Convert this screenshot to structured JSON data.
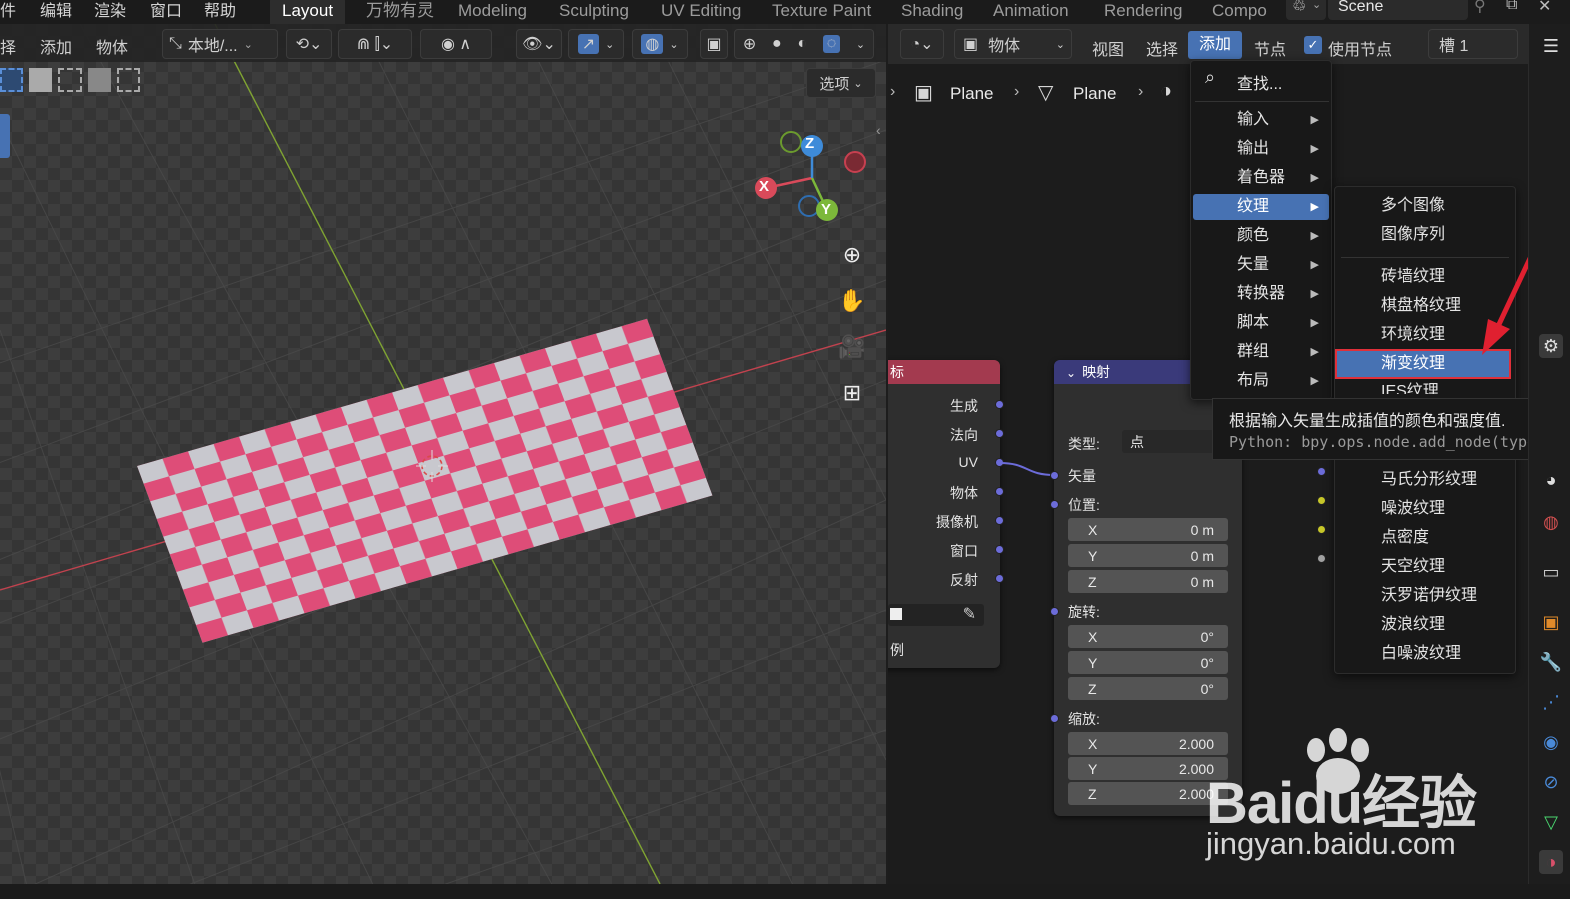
{
  "topbar": {
    "menus": [
      "件",
      "编辑",
      "渲染",
      "窗口",
      "帮助"
    ],
    "workspaces": [
      "Layout",
      "万物有灵",
      "Modeling",
      "Sculpting",
      "UV Editing",
      "Texture Paint",
      "Shading",
      "Animation",
      "Rendering",
      "Compo"
    ],
    "active_workspace": "Layout",
    "scene_label": "Scene"
  },
  "viewport": {
    "menu": [
      "择",
      "添加",
      "物体"
    ],
    "transform_orientation": "本地/...",
    "options_label": "选项",
    "gizmo": {
      "x": "X",
      "y": "Y",
      "z": "Z"
    },
    "colors": {
      "checker_pink": "#de4d78",
      "checker_light": "#c8c8ce",
      "axis_x": "#c1424e",
      "axis_y": "#7fa332"
    }
  },
  "node_editor": {
    "header": {
      "object_mode": "物体",
      "view": "视图",
      "select": "选择",
      "add": "添加",
      "node": "节点",
      "use_nodes": "使用节点",
      "slot": "槽 1"
    },
    "breadcrumb": [
      "Plane",
      "Plane"
    ],
    "texcoord_node": {
      "title": "标",
      "outputs": [
        "生成",
        "法向",
        "UV",
        "物体",
        "摄像机",
        "窗口",
        "反射"
      ],
      "footer": "例"
    },
    "mapping_node": {
      "title": "映射",
      "type_label": "类型:",
      "type_value": "点",
      "vector_label": "矢量",
      "location_label": "位置:",
      "location": [
        {
          "axis": "X",
          "value": "0 m"
        },
        {
          "axis": "Y",
          "value": "0 m"
        },
        {
          "axis": "Z",
          "value": "0 m"
        }
      ],
      "rotation_label": "旋转:",
      "rotation": [
        {
          "axis": "X",
          "value": "0°"
        },
        {
          "axis": "Y",
          "value": "0°"
        },
        {
          "axis": "Z",
          "value": "0°"
        }
      ],
      "scale_label": "缩放:",
      "scale": [
        {
          "axis": "X",
          "value": "2.000"
        },
        {
          "axis": "Y",
          "value": "2.000"
        },
        {
          "axis": "Z",
          "value": "2.000"
        }
      ]
    }
  },
  "add_menu": {
    "search": "查找...",
    "items": [
      "输入",
      "输出",
      "着色器",
      "纹理",
      "颜色",
      "矢量",
      "转换器",
      "脚本",
      "群组",
      "布局"
    ],
    "selected": "纹理"
  },
  "texture_submenu": {
    "items_a": [
      "多个图像",
      "图像序列"
    ],
    "items_b": [
      "砖墙纹理",
      "棋盘格纹理",
      "环境纹理",
      "渐变纹理",
      "IES纹理"
    ],
    "items_c": [
      "马氏分形纹理",
      "噪波纹理",
      "点密度",
      "天空纹理",
      "沃罗诺伊纹理",
      "波浪纹理",
      "白噪波纹理"
    ],
    "selected": "渐变纹理"
  },
  "tooltip": {
    "description": "根据输入矢量生成插值的颜色和强度值.",
    "python": "Python: bpy.ops.node.add_node(type=\"Sh"
  },
  "watermark": {
    "brand": "Baidu经验",
    "url": "jingyan.baidu.com"
  }
}
